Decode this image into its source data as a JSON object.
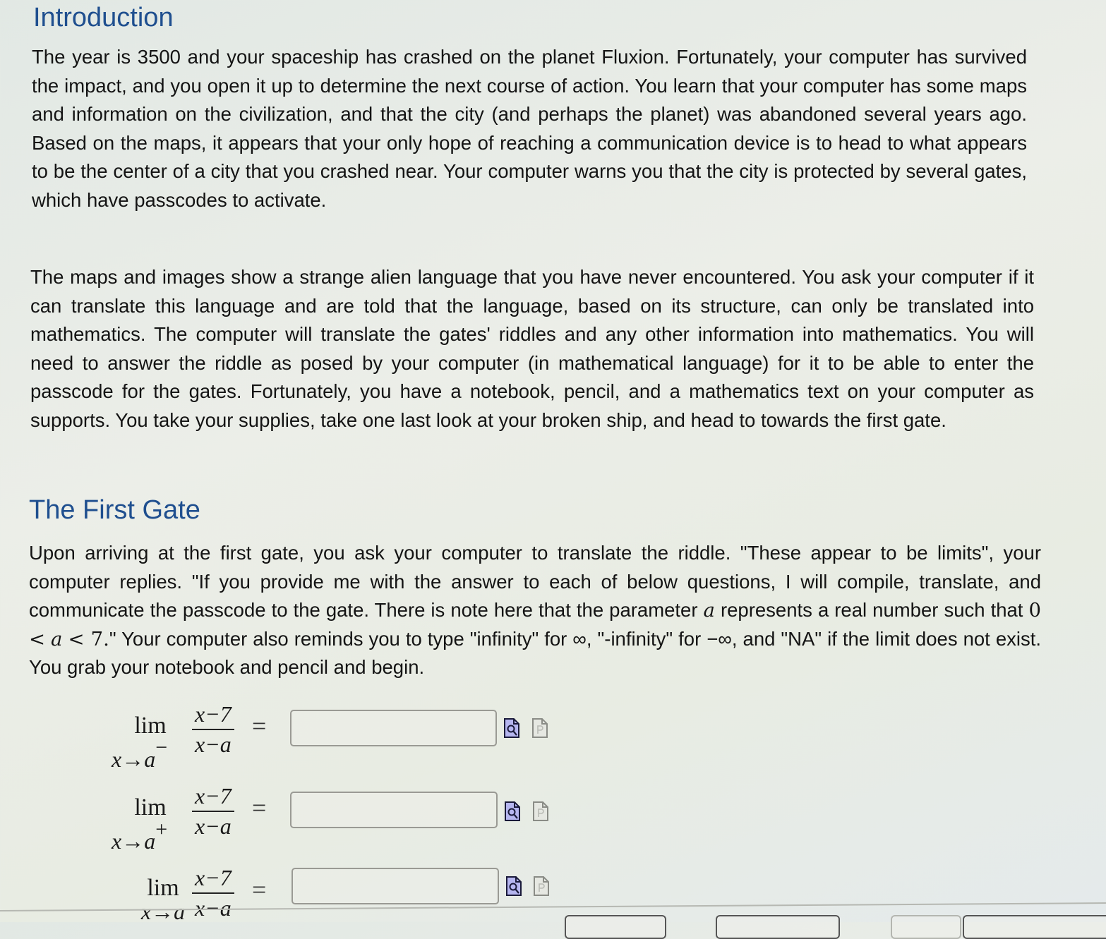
{
  "intro": {
    "title": "Introduction",
    "paragraph1": "The year is 3500 and your spaceship has crashed on the planet Fluxion. Fortunately, your computer has survived the impact, and you open it up to determine the next course of action. You learn that your computer has some maps and information on the civilization, and that the city (and perhaps the planet) was abandoned several years ago. Based on the maps, it appears that your only hope of reaching a communication device is to head to what appears to be the center of a city that you crashed near. Your computer warns you that the city is protected by several gates, which have passcodes to activate.",
    "paragraph2": "The maps and images show a strange alien language that you have never encountered. You ask your computer if it can translate this language and are told that the language, based on its structure, can only be translated into mathematics. The computer will translate the gates' riddles and any other information into mathematics. You will need to answer the riddle as posed by your computer (in mathematical language) for it to be able to enter the passcode for the gates. Fortunately, you have a notebook, pencil, and a mathematics text on your computer as supports. You take your supplies, take one last look at your broken ship, and head to towards the first gate."
  },
  "first_gate": {
    "title": "The First Gate",
    "p_part1": "Upon arriving at the first gate, you ask your computer to translate the riddle. \"These appear to be limits\", your computer replies. \"If you provide me with the answer to each of below questions, I will compile, translate, and communicate the passcode to the gate. There is note here that the parameter ",
    "param": "a",
    "p_part2": " represents a real number such that ",
    "ineq_left": "0 <",
    "ineq_var": "a",
    "ineq_right": "< 7.",
    "p_part3": "\" Your computer also reminds you to type \"infinity\" for ∞, \"-infinity\" for −∞, and \"NA\" if the limit does not exist. You grab your notebook and pencil and begin."
  },
  "limits": [
    {
      "lim_word": "lim",
      "approach": "x→a",
      "side": "−",
      "numerator": "x−7",
      "denominator": "x−a",
      "equals": "=",
      "answer_value": "",
      "answer_placeholder": "",
      "preview_icon": "preview-answer-icon",
      "help_icon": "answer-help-icon"
    },
    {
      "lim_word": "lim",
      "approach": "x→a",
      "side": "+",
      "numerator": "x−7",
      "denominator": "x−a",
      "equals": "=",
      "answer_value": "",
      "answer_placeholder": "",
      "preview_icon": "preview-answer-icon",
      "help_icon": "answer-help-icon"
    },
    {
      "lim_word": "lim",
      "approach": "x→a",
      "side": "",
      "numerator": "x−7",
      "denominator": "x−a",
      "equals": "=",
      "answer_value": "",
      "answer_placeholder": "",
      "preview_icon": "preview-answer-icon",
      "help_icon": "answer-help-icon"
    }
  ],
  "colors": {
    "heading": "#1f4f8f",
    "text": "#141414",
    "preview_icon_fill": "#b6b6f0",
    "help_icon_fill": "#e6e8e2"
  }
}
